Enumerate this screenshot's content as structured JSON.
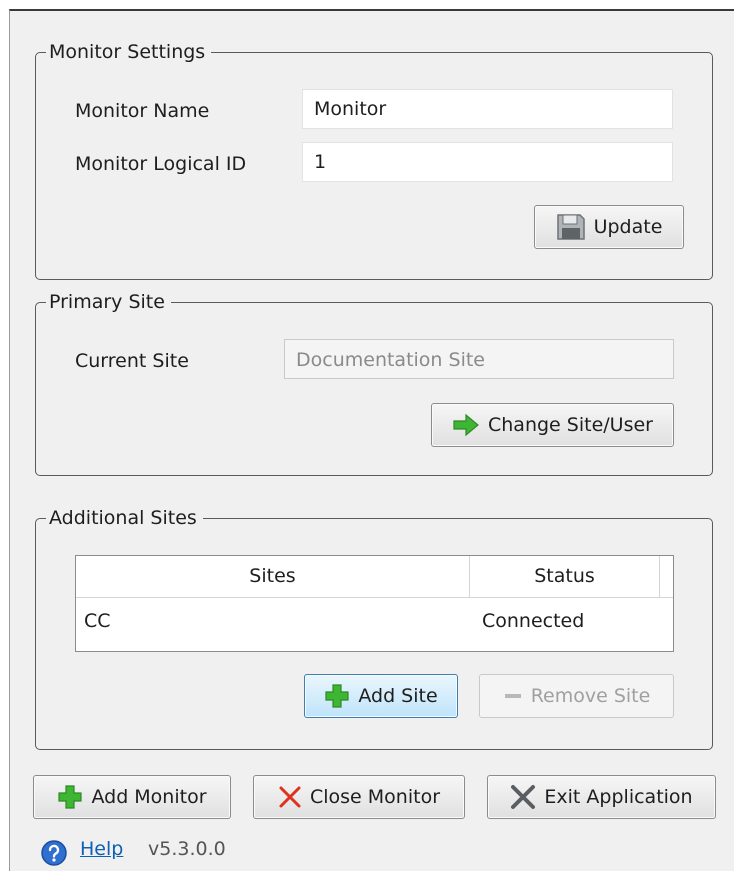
{
  "monitor_settings": {
    "title": "Monitor Settings",
    "name_label": "Monitor Name",
    "name_value": "Monitor",
    "id_label": "Monitor Logical ID",
    "id_value": "1",
    "update_label": "Update"
  },
  "primary_site": {
    "title": "Primary Site",
    "current_site_label": "Current Site",
    "current_site_value": "Documentation Site",
    "change_label": "Change Site/User"
  },
  "additional_sites": {
    "title": "Additional Sites",
    "columns": [
      "Sites",
      "Status"
    ],
    "rows": [
      {
        "site": "CC",
        "status": "Connected"
      }
    ],
    "add_label": "Add Site",
    "remove_label": "Remove Site"
  },
  "footer": {
    "add_monitor_label": "Add Monitor",
    "close_monitor_label": "Close Monitor",
    "exit_label": "Exit Application",
    "help_label": "Help",
    "version": "v5.3.0.0"
  },
  "icons": {
    "update": "floppy-disk-icon",
    "change": "green-arrow-right-icon",
    "add": "green-plus-icon",
    "remove": "minus-icon",
    "close": "red-x-icon",
    "exit": "gray-x-icon",
    "help": "help-question-icon"
  },
  "colors": {
    "accent_green": "#3fb534",
    "close_red": "#e0301e",
    "link_blue": "#0f5fb5",
    "hot_button_border": "#3c7fb1"
  }
}
